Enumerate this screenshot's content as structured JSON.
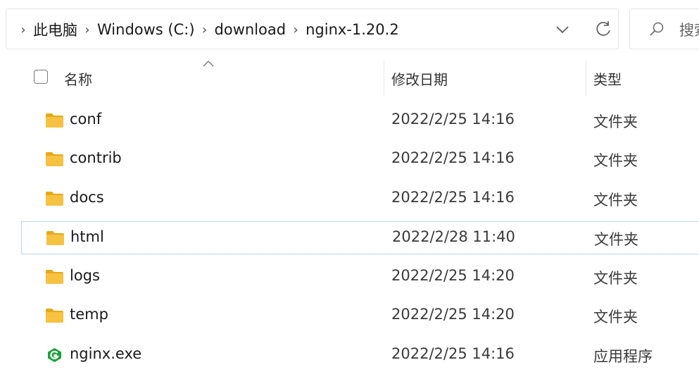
{
  "address_bar": {
    "breadcrumbs": [
      "此电脑",
      "Windows (C:)",
      "download",
      "nginx-1.20.2"
    ]
  },
  "search": {
    "placeholder": "搜索"
  },
  "columns": {
    "name": "名称",
    "date": "修改日期",
    "type": "类型"
  },
  "files": [
    {
      "name": "conf",
      "date": "2022/2/25 14:16",
      "type": "文件夹",
      "icon": "folder-icon"
    },
    {
      "name": "contrib",
      "date": "2022/2/25 14:16",
      "type": "文件夹",
      "icon": "folder-icon"
    },
    {
      "name": "docs",
      "date": "2022/2/25 14:16",
      "type": "文件夹",
      "icon": "folder-icon"
    },
    {
      "name": "html",
      "date": "2022/2/28 11:40",
      "type": "文件夹",
      "icon": "folder-icon"
    },
    {
      "name": "logs",
      "date": "2022/2/25 14:20",
      "type": "文件夹",
      "icon": "folder-icon"
    },
    {
      "name": "temp",
      "date": "2022/2/25 14:20",
      "type": "文件夹",
      "icon": "folder-icon"
    },
    {
      "name": "nginx.exe",
      "date": "2022/2/25 14:16",
      "type": "应用程序",
      "icon": "nginx-app-icon"
    }
  ],
  "colors": {
    "folder": "#f5c242",
    "selection_border": "#b9d8f2",
    "nginx_green": "#1aa33a"
  }
}
